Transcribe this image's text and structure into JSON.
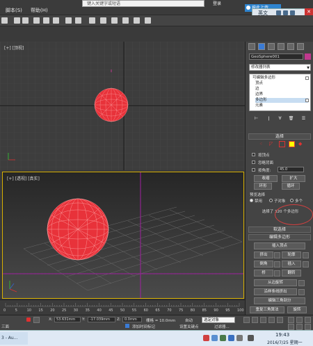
{
  "menubar": {
    "items": [
      "脚本(S)",
      "帮助(H)"
    ],
    "search_placeholder": "键入关键字或短语",
    "login": "登录",
    "ime_tip": "按此上传",
    "ime_lang": "英文",
    "close": "✕"
  },
  "viewports": {
    "top_label": "[+] [顶视]",
    "persp_label": "[+] [透视] [真实]"
  },
  "timeline": {
    "ticks": [
      "0",
      "5",
      "10",
      "15",
      "20",
      "25",
      "30",
      "35",
      "40",
      "45",
      "50",
      "55",
      "60",
      "65",
      "70",
      "75",
      "80",
      "85",
      "90",
      "95",
      "100"
    ]
  },
  "statusbar": {
    "x_label": "X:",
    "x_value": "53.631mm",
    "y_label": "Y:",
    "y_value": "-17.039mm",
    "z_label": "Z:",
    "z_value": "0.0mm",
    "grid": "栅格 = 10.0mm",
    "auto_key": "自动",
    "set_key": "设置关键点",
    "key_filter": "过滤器...",
    "selected": "选定对象",
    "add_time_tag": "添加时间标记",
    "left_status": "三面"
  },
  "taskbar": {
    "app": "3 - Au...",
    "time": "19:43",
    "date": "2016/7/25 星期一"
  },
  "command_panel": {
    "object_name": "GeoSphere001",
    "modifier_list": "修改器列表",
    "stack": [
      "可编辑多边形",
      "顶点",
      "边",
      "边界",
      "多边形",
      "元素"
    ],
    "selected_stack_index": 4,
    "selection": {
      "title": "选择",
      "by_vertex": "按顶点",
      "ignore_backfacing": "忽略背面",
      "by_angle": "按角度:",
      "angle_value": "45.0",
      "shrink": "收缩",
      "grow": "扩大",
      "ring": "环形",
      "loop": "循环",
      "preview_title": "预览选择",
      "preview_options": [
        "禁用",
        "子对象",
        "多个"
      ],
      "preview_selected": 0,
      "status": "选择了 320 个多边形"
    },
    "soft_selection": "软选择",
    "edit_polygons": {
      "title": "编辑多边形",
      "insert_vertex": "插入顶点",
      "extrude": "挤出",
      "outline": "轮廓",
      "bevel": "倒角",
      "inset": "插入",
      "bridge": "桥",
      "flip": "翻转",
      "hinge": "从边旋转",
      "extrude_along_spline": "沿样条线挤出",
      "edit_triangulation": "编辑三角剖分",
      "retriangulate": "重复三角算法",
      "turn": "旋转"
    }
  },
  "colors": {
    "sphere": "#e8323a",
    "selection_highlight": "#c7ddf2",
    "active_border": "#d8b000",
    "object_color": "#c0398e"
  }
}
